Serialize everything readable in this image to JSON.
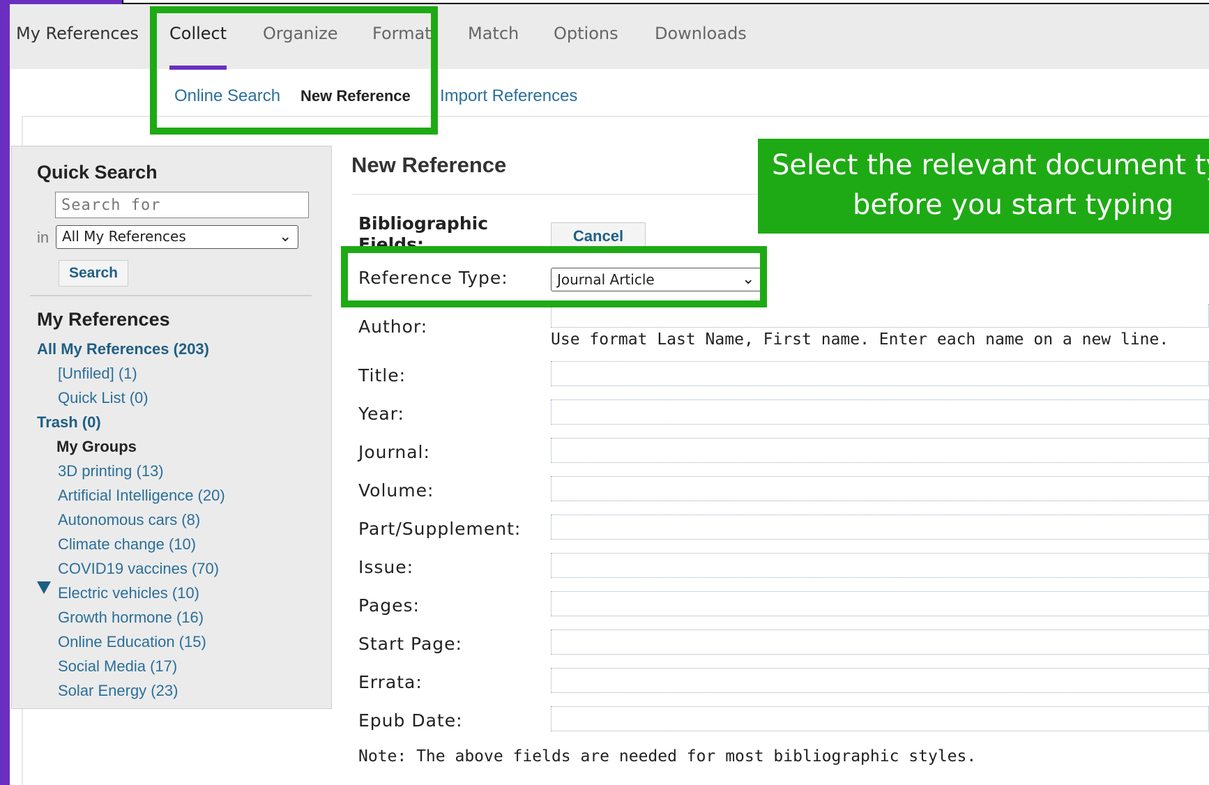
{
  "nav": {
    "items": [
      "My References",
      "Collect",
      "Organize",
      "Format",
      "Match",
      "Options",
      "Downloads"
    ],
    "active": "Collect"
  },
  "subnav": {
    "items": [
      "Online Search",
      "New Reference",
      "Import References"
    ],
    "active": "New Reference"
  },
  "sidebar": {
    "quick_search_title": "Quick Search",
    "search_placeholder": "Search for",
    "in_label": "in",
    "scope_value": "All My References",
    "search_button": "Search",
    "my_references_title": "My References",
    "all_refs": "All My References (203)",
    "unfiled": "[Unfiled] (1)",
    "quick_list": "Quick List (0)",
    "trash": "Trash (0)",
    "my_groups": "My Groups",
    "groups": [
      "3D printing (13)",
      "Artificial Intelligence (20)",
      "Autonomous cars (8)",
      "Climate change (10)",
      "COVID19 vaccines (70)",
      "Electric vehicles (10)",
      "Growth hormone (16)",
      "Online Education (15)",
      "Social Media (17)",
      "Solar Energy (23)"
    ]
  },
  "main": {
    "title": "New Reference",
    "bib_label": "Bibliographic Fields:",
    "cancel_button": "Cancel",
    "reference_type_label": "Reference Type:",
    "reference_type_value": "Journal Article",
    "author_label": "Author:",
    "author_help": "Use format Last Name, First name. Enter each name on a new line.",
    "fields": [
      "Title:",
      "Year:",
      "Journal:",
      "Volume:",
      "Part/Supplement:",
      "Issue:",
      "Pages:",
      "Start Page:",
      "Errata:",
      "Epub Date:"
    ],
    "note": "Note: The above fields are needed for most bibliographic styles."
  },
  "callout": {
    "line1": "Select the relevant document type",
    "line2": "before you start typing"
  },
  "colors": {
    "accent_purple": "#6a2fc0",
    "highlight_green": "#1eaa14",
    "link_blue": "#2a6f9a"
  }
}
